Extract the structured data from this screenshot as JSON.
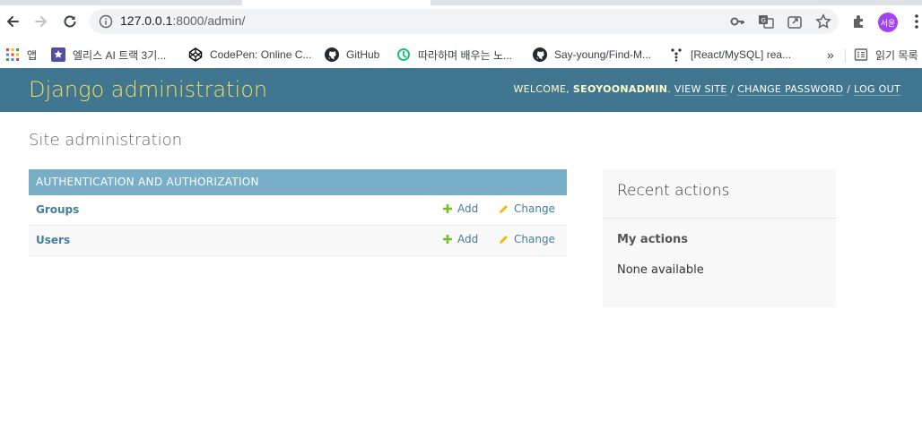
{
  "browser": {
    "url_host": "127.0.0.1",
    "url_path": ":8000/admin/",
    "avatar_text": "서윤",
    "bookmarks": [
      {
        "label": "앱",
        "icon": "apps-grid-icon"
      },
      {
        "label": "엘리스 AI 트랙 3기...",
        "icon": "elice-icon"
      },
      {
        "label": "CodePen: Online C...",
        "icon": "codepen-icon"
      },
      {
        "label": "GitHub",
        "icon": "github-icon"
      },
      {
        "label": "따라하며 배우는 노...",
        "icon": "inflearn-icon"
      },
      {
        "label": "Say-young/Find-M...",
        "icon": "github-icon"
      },
      {
        "label": "[React/MySQL] rea...",
        "icon": "velog-icon"
      }
    ],
    "more_bookmarks": "»",
    "reading_list": "읽기 목록"
  },
  "admin": {
    "site_name": "Django administration",
    "welcome": "WELCOME,",
    "username": "SEOYOONADMIN",
    "view_site": "VIEW SITE",
    "change_password": "CHANGE PASSWORD",
    "log_out": "LOG OUT",
    "page_title": "Site administration",
    "app_caption": "AUTHENTICATION AND AUTHORIZATION",
    "models": [
      {
        "name": "Groups",
        "add": "Add",
        "change": "Change"
      },
      {
        "name": "Users",
        "add": "Add",
        "change": "Change"
      }
    ],
    "recent_actions_title": "Recent actions",
    "my_actions_title": "My actions",
    "none_available": "None available"
  },
  "colors": {
    "header_bg": "#417690",
    "site_name": "#f5dd5d",
    "caption_bg": "#79aec8",
    "link": "#447e9b",
    "add_icon": "#70bf2b",
    "change_icon": "#efb80b"
  }
}
